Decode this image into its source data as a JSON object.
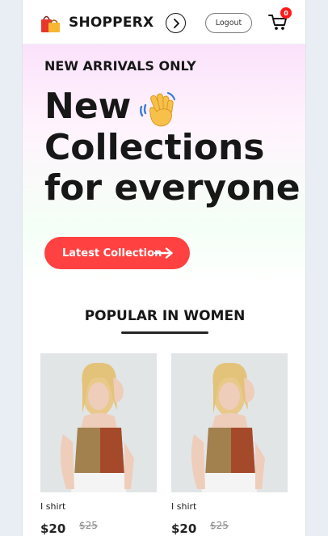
{
  "navbar": {
    "brand": "SHOPPERX",
    "logout_label": "Logout",
    "cart_count": "0"
  },
  "hero": {
    "subtitle": "NEW ARRIVALS ONLY",
    "title_line1": "New",
    "title_line2": "Collections",
    "title_line3": "for everyone",
    "cta_label": "Latest Collection"
  },
  "popular": {
    "heading": "POPULAR IN WOMEN",
    "products": [
      {
        "name": "I shirt",
        "new_price": "$20",
        "old_price": "$25"
      },
      {
        "name": "I shirt",
        "new_price": "$20",
        "old_price": "$25"
      }
    ]
  },
  "colors": {
    "accent": "#ff4141",
    "badge": "#ff1a1a",
    "text": "#171717"
  }
}
